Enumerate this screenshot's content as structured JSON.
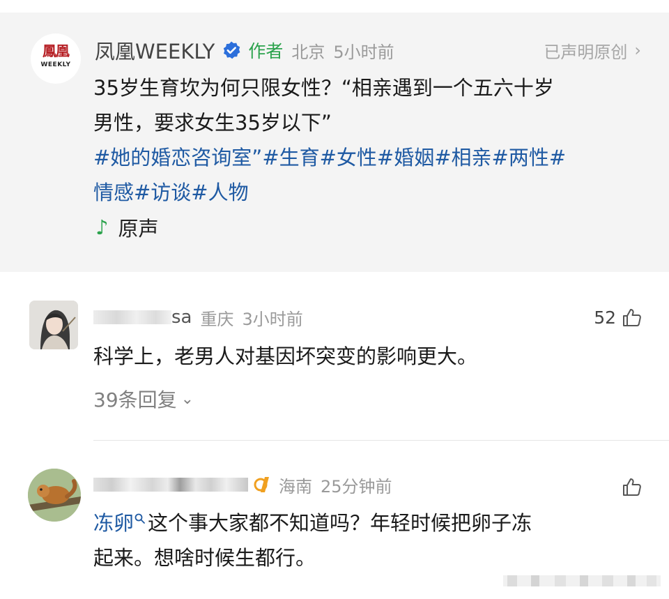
{
  "post": {
    "author": "凤凰WEEKLY",
    "author_tag": "作者",
    "location": "北京",
    "time": "5小时前",
    "declare_label": "已声明原创",
    "declare_chevron": "›",
    "logo_text": "鳳凰",
    "logo_sub": "WEEKLY",
    "text_line1": "35岁生育坎为何只限女性？“相亲遇到一个五六十岁",
    "text_line2": "男性，要求女生35岁以下”",
    "tags_line1": "#她的婚恋咨询室”#生育#女性#婚姻#相亲#两性#",
    "tags_line2": "情感#访谈#人物",
    "sound_icon": "♪",
    "sound_label": "原声"
  },
  "comments": [
    {
      "username_suffix": "sa",
      "location": "重庆",
      "time": "3小时前",
      "likes": "52",
      "text": "科学上，老男人对基因坏突变的影响更大。",
      "replies_label": "39条回复",
      "replies_chevron": "⌄"
    },
    {
      "location": "海南",
      "time": "25分钟前",
      "search_link": "冻卵",
      "text_rest_line1": "这个事大家都不知道吗？年轻时候把卵子冻",
      "text_line2": "起来。想啥时候生都行。"
    }
  ],
  "colors": {
    "accent_green": "#2ba24c",
    "link_blue": "#1f5aa3",
    "verified_blue": "#2c6fdb",
    "brand_red": "#b61f24",
    "post_bg": "#f4f4f4"
  },
  "icons": {
    "verified": "verified-badge-icon",
    "like": "thumbs-up-icon",
    "search": "search-icon",
    "music": "music-note-icon",
    "chevron_right": "chevron-right-icon",
    "chevron_down": "chevron-down-icon"
  }
}
